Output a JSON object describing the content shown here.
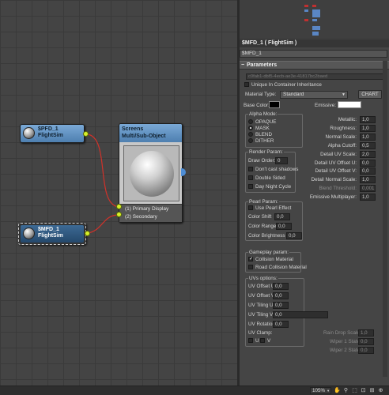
{
  "nodes": {
    "pfd": {
      "title_line1": "$PFD_1",
      "title_line2": "FlightSim"
    },
    "mfd": {
      "title_line1": "$MFD_1",
      "title_line2": "FlightSim"
    },
    "screens": {
      "title_line1": "Screens",
      "title_line2": "Multi/Sub-Object",
      "slots": [
        "(1) Primary Display",
        "(2) Secondary"
      ]
    }
  },
  "panel": {
    "material_title": "$MFD_1  ( FlightSim )",
    "material_name": "$MFD_1",
    "rollout_title": "Parameters",
    "guid": "c0fab1-dbf5-4ecb-ae3e-41817bc2baed",
    "unique_label": "Unique In Container Inheritance",
    "material_type_label": "Material Type:",
    "material_type_value": "Standard",
    "chart_button": "CHART",
    "base_color_label": "Base Color:",
    "emissive_label": "Emissive:",
    "alpha_mode": {
      "title": "Alpha Mode:",
      "options": [
        "OPAQUE",
        "MASK",
        "BLEND",
        "DITHER"
      ],
      "selected": "MASK"
    },
    "right_params": [
      {
        "label": "Metallic:",
        "value": "1,0"
      },
      {
        "label": "Roughness:",
        "value": "1,0"
      },
      {
        "label": "Normal Scale:",
        "value": "1,0"
      },
      {
        "label": "Alpha Cutoff:",
        "value": "0,5"
      },
      {
        "label": "Detail UV Scale:",
        "value": "2,0"
      },
      {
        "label": "Detail UV Offset U:",
        "value": "0,0"
      },
      {
        "label": "Detail UV Offset V:",
        "value": "0,0"
      },
      {
        "label": "Detail Normal Scale:",
        "value": "1,0"
      },
      {
        "label": "Blend Threshold:",
        "value": "0,001"
      },
      {
        "label": "Emissive Multiplayer:",
        "value": "1,0"
      }
    ],
    "render_param": {
      "title": "Render Param:",
      "draw_order_label": "Draw Order:",
      "draw_order_value": "0",
      "checks": [
        "Don't cast shadows",
        "Double Sided",
        "Day Night Cycle"
      ]
    },
    "pearl_param": {
      "title": "Pearl Param:",
      "use_label": "Use Pearl Effect",
      "rows": [
        {
          "label": "Color Shift",
          "value": "0,0"
        },
        {
          "label": "Color Range",
          "value": "0,0"
        },
        {
          "label": "Color Brightness",
          "value": "0,0"
        }
      ]
    },
    "gameplay_param": {
      "title": "Gameplay param:",
      "checks": [
        "Collision Material",
        "Road Collision Material"
      ],
      "checked": [
        "Collision Material"
      ]
    },
    "uvs": {
      "title": "UVs options:",
      "rows": [
        {
          "label": "UV Offset U:",
          "value": "0,0"
        },
        {
          "label": "UV Offset V:",
          "value": "0,0"
        },
        {
          "label": "UV Tiling U:",
          "value": "0,0"
        },
        {
          "label": "UV Tiling V:",
          "value": "0,0"
        },
        {
          "label": "UV Rotation:",
          "value": "0,0"
        }
      ],
      "clamp_title": "UV Clamp:",
      "clamp_u": "U",
      "clamp_v": "V"
    },
    "rain": [
      {
        "label": "Rain Drop Scale:",
        "value": "1,0"
      },
      {
        "label": "Wiper 1 State:",
        "value": "0,0"
      },
      {
        "label": "Wiper 2 State:",
        "value": "0,0"
      }
    ]
  },
  "status": {
    "zoom": "105%"
  }
}
